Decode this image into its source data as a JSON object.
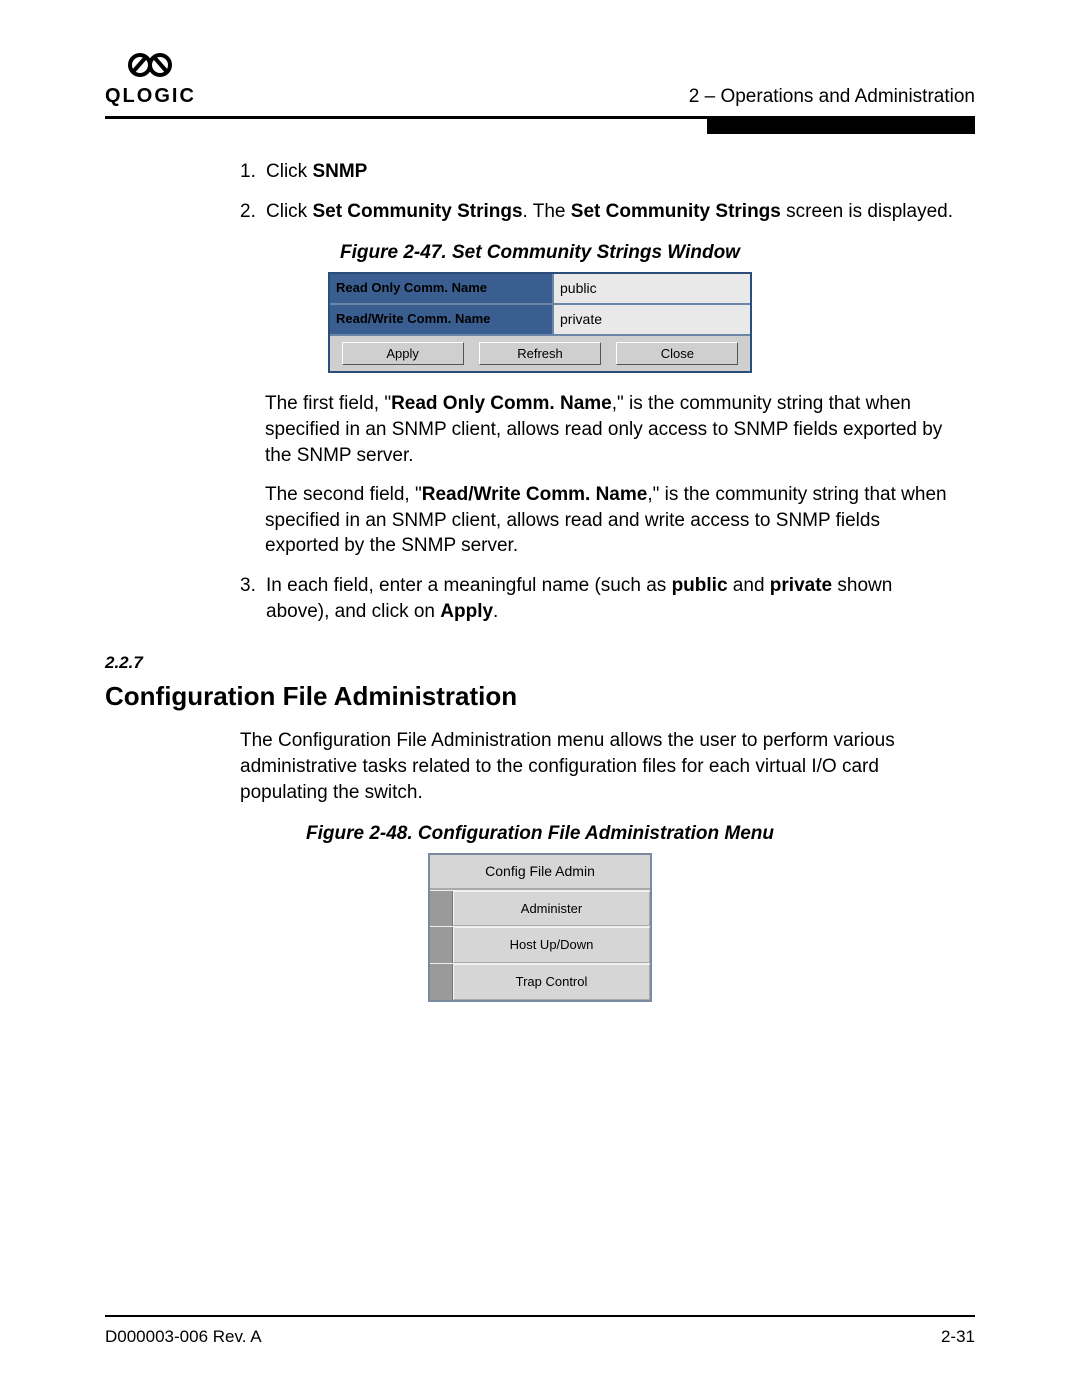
{
  "header": {
    "logo_word": "QLOGIC",
    "section_label": "2 – Operations and Administration"
  },
  "steps": {
    "s1_num": "1.",
    "s1_a": "Click ",
    "s1_b": "SNMP",
    "s2_num": "2.",
    "s2_a": "Click ",
    "s2_b": "Set Community Strings",
    "s2_c": ". The ",
    "s2_d": "Set Community Strings",
    "s2_e": " screen is displayed.",
    "s3_num": "3.",
    "s3_a": "In each field, enter a meaningful name (such as ",
    "s3_b": "public",
    "s3_c": " and ",
    "s3_d": "private",
    "s3_e": " shown above), and click on ",
    "s3_f": "Apply",
    "s3_g": "."
  },
  "fig47": {
    "caption": "Figure 2-47. Set Community Strings Window",
    "row1_label": "Read Only Comm. Name",
    "row1_value": "public",
    "row2_label": "Read/Write Comm. Name",
    "row2_value": "private",
    "btn_apply": "Apply",
    "btn_refresh": "Refresh",
    "btn_close": "Close"
  },
  "para1": {
    "a": "The first field, \"",
    "b": "Read Only Comm. Name",
    "c": ",\" is the community string that when specified in an SNMP client, allows read only access to SNMP fields exported by the SNMP server."
  },
  "para2": {
    "a": "The second field, \"",
    "b": "Read/Write Comm. Name",
    "c": ",\" is the community string that when specified in an SNMP client, allows read and write access to SNMP fields exported by the SNMP server."
  },
  "section": {
    "num": "2.2.7",
    "title": "Configuration File Administration",
    "intro": "The Configuration File Administration menu allows the user to perform various administrative tasks related to the configuration files for each virtual I/O card populating the switch."
  },
  "fig48": {
    "caption": "Figure 2-48. Configuration File Administration Menu",
    "header": "Config File Admin",
    "item1": "Administer",
    "item2": "Host Up/Down",
    "item3": "Trap Control"
  },
  "footer": {
    "left": "D000003-006 Rev. A",
    "right": "2-31"
  }
}
